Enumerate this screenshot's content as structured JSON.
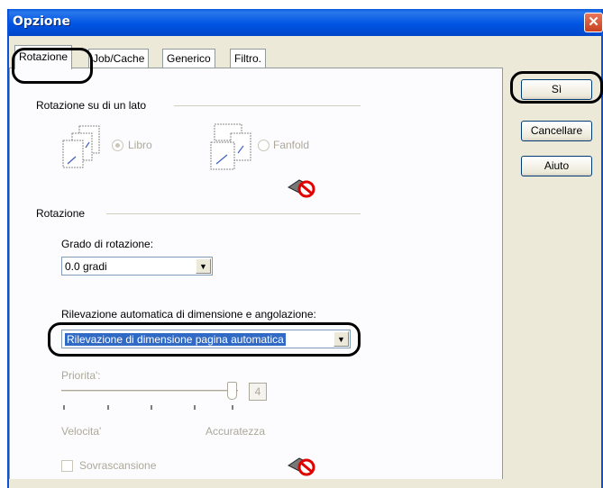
{
  "window": {
    "title": "Opzione",
    "close_glyph": "✕"
  },
  "tabs": [
    {
      "label": "Rotazione"
    },
    {
      "label": "Job/Cache"
    },
    {
      "label": "Generico"
    },
    {
      "label": "Filtro."
    }
  ],
  "buttons": {
    "ok": "Sì",
    "cancel": "Cancellare",
    "help": "Aiuto"
  },
  "rotation_one_side": {
    "group_label": "Rotazione su di un lato",
    "option_book": "Libro",
    "option_fanfold": "Fanfold",
    "selected": "Libro"
  },
  "rotation": {
    "group_label": "Rotazione",
    "degree_label": "Grado di rotazione:",
    "degree_value": "0.0 gradi",
    "auto_label": "Rilevazione automatica di dimensione e angolazione:",
    "auto_value": "Rilevazione di dimensione pagina automatica",
    "priority_label": "Priorita':",
    "priority_value": "4",
    "speed_label": "Velocita'",
    "accuracy_label": "Accuratezza",
    "overscan_label": "Sovrascansione"
  },
  "icons": {
    "document_book": "document-pages-icon",
    "document_fanfold": "document-fanfold-icon",
    "not_available": "scanner-not-available-icon"
  },
  "colors": {
    "title_blue": "#0054e3",
    "selection": "#316ac5",
    "disabled_text": "#aca899"
  }
}
